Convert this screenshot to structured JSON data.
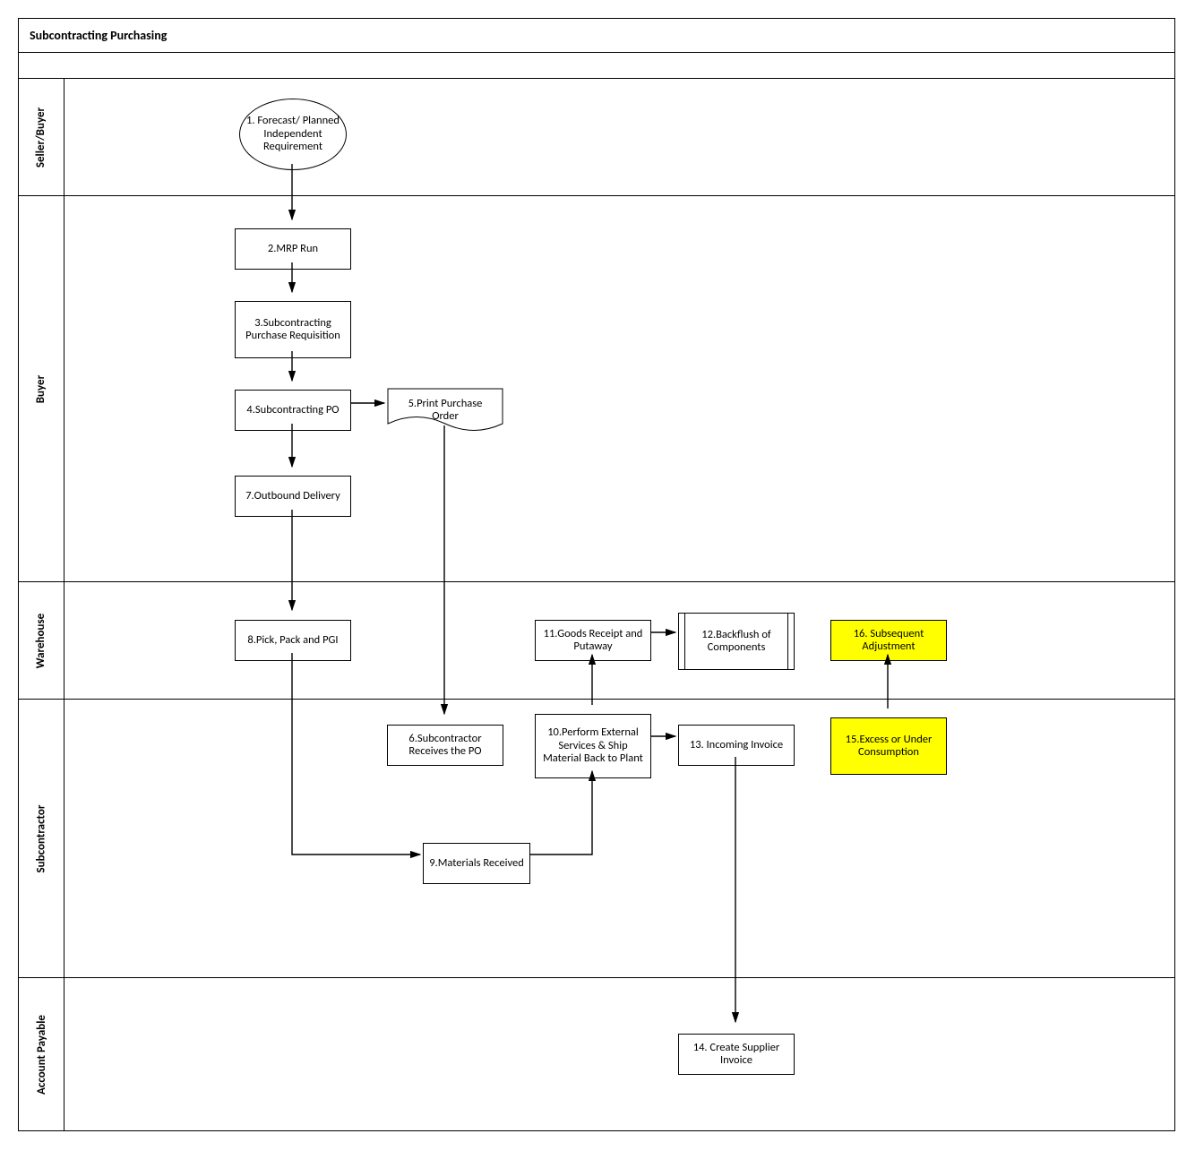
{
  "title": "Subcontracting Purchasing",
  "lanes": {
    "seller_buyer": "Seller/Buyer",
    "buyer": "Buyer",
    "warehouse": "Warehouse",
    "subcontractor": "Subcontractor",
    "account_payable": "Account Payable"
  },
  "nodes": {
    "n1": "1. Forecast/ Planned Independent Requirement",
    "n2": "2.MRP Run",
    "n3": "3.Subcontracting Purchase Requisition",
    "n4": "4.Subcontracting PO",
    "n5": "5.Print Purchase Order",
    "n6": "6.Subcontractor Receives the PO",
    "n7": "7.Outbound Delivery",
    "n8": "8.Pick, Pack and PGI",
    "n9": "9.Materials Received",
    "n10": "10.Perform External Services & Ship Material Back to Plant",
    "n11": "11.Goods Receipt and Putaway",
    "n12": "12.Backflush of Components",
    "n13": "13. Incoming Invoice",
    "n14": "14. Create Supplier Invoice",
    "n15": "15.Excess or Under Consumption",
    "n16": "16. Subsequent Adjustment"
  },
  "flow": [
    [
      "n1",
      "n2"
    ],
    [
      "n2",
      "n3"
    ],
    [
      "n3",
      "n4"
    ],
    [
      "n4",
      "n5"
    ],
    [
      "n4",
      "n7"
    ],
    [
      "n5",
      "n6"
    ],
    [
      "n7",
      "n8"
    ],
    [
      "n8",
      "n9"
    ],
    [
      "n9",
      "n10"
    ],
    [
      "n10",
      "n11"
    ],
    [
      "n10",
      "n13"
    ],
    [
      "n11",
      "n12"
    ],
    [
      "n13",
      "n14"
    ],
    [
      "n15",
      "n16"
    ]
  ]
}
